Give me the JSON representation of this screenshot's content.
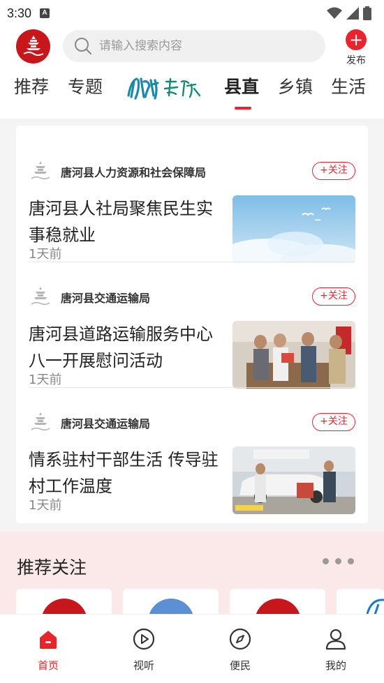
{
  "status_bar": {
    "time": "3:30"
  },
  "header": {
    "search_placeholder": "请输入搜索内容",
    "publish_label": "发布",
    "tabs": [
      {
        "label": "推荐"
      },
      {
        "label": "专题"
      },
      {
        "label": "县直"
      },
      {
        "label": "乡镇"
      },
      {
        "label": "生活"
      }
    ],
    "active_tab": "县直"
  },
  "news": [
    {
      "source": "唐河县人力资源和社会保障局",
      "follow_label": "+关注",
      "title": "唐河县人社局聚焦民生实事稳就业",
      "time": "1天前",
      "thumb": "sky-clouds-birds"
    },
    {
      "source": "唐河县交通运输局",
      "follow_label": "+关注",
      "title": "唐河县道路运输服务中心八一开展慰问活动",
      "time": "1天前",
      "thumb": "people-indoor-visit"
    },
    {
      "source": "唐河县交通运输局",
      "follow_label": "+关注",
      "title": "情系驻村干部生活 传导驻村工作温度",
      "time": "1天前",
      "thumb": "people-outdoor-car"
    }
  ],
  "recommend": {
    "title": "推荐关注"
  },
  "bottom_nav": [
    {
      "label": "首页",
      "icon": "home-icon",
      "active": true
    },
    {
      "label": "视听",
      "icon": "play-icon",
      "active": false
    },
    {
      "label": "便民",
      "icon": "compass-icon",
      "active": false
    },
    {
      "label": "我的",
      "icon": "user-icon",
      "active": false
    }
  ],
  "colors": {
    "accent": "#e8252c",
    "brand_red": "#c8161d",
    "recommend_bg": "#fbe9ea"
  }
}
